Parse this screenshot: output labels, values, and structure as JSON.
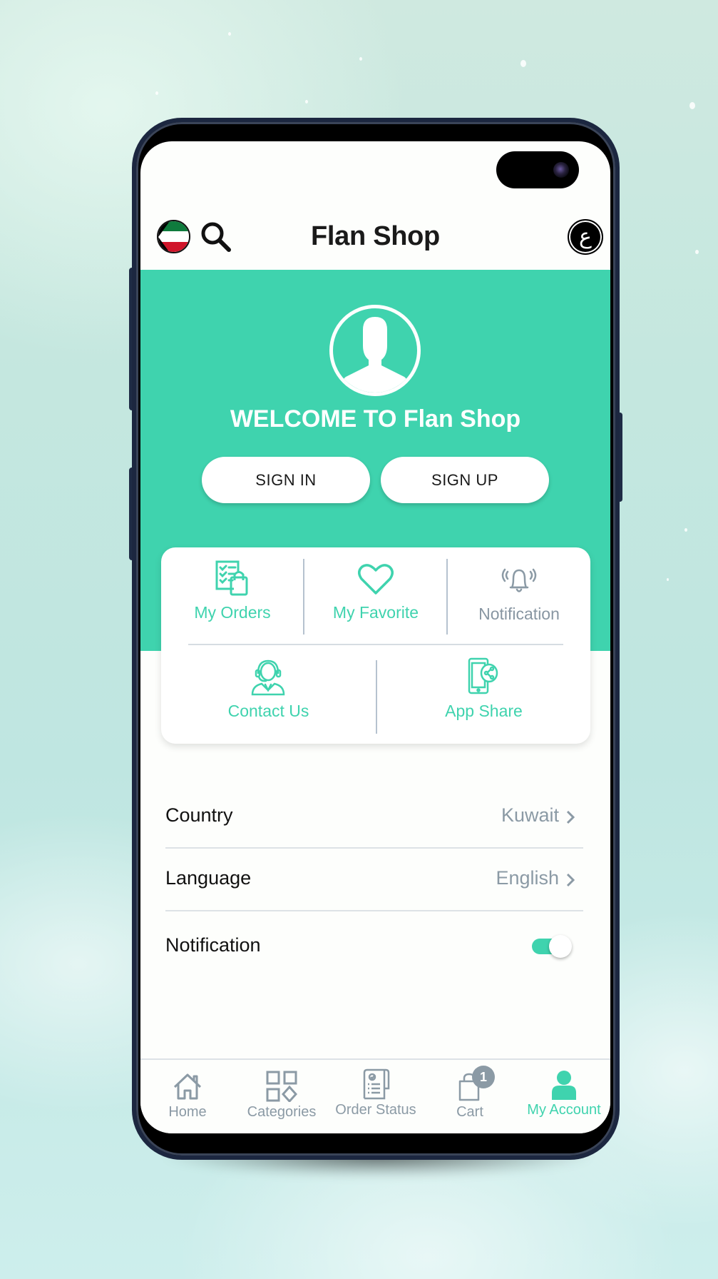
{
  "app": {
    "title": "Flan Shop",
    "accent_color": "#3fd3ae",
    "muted_color": "#8b9aa5"
  },
  "header": {
    "country_flag": "kuwait-flag",
    "search_icon": "search-icon",
    "title": "Flan Shop",
    "language_toggle_glyph": "ع"
  },
  "hero": {
    "avatar_icon": "user-silhouette-icon",
    "welcome_text": "WELCOME TO Flan Shop",
    "sign_in_label": "SIGN IN",
    "sign_up_label": "SIGN UP"
  },
  "quick_actions": [
    {
      "label": "My Orders",
      "icon": "orders-checklist-bag-icon",
      "state": "active"
    },
    {
      "label": "My Favorite",
      "icon": "heart-icon",
      "state": "active"
    },
    {
      "label": "Notification",
      "icon": "ringing-bell-icon",
      "state": "muted"
    },
    {
      "label": "Contact Us",
      "icon": "support-agent-headset-icon",
      "state": "active"
    },
    {
      "label": "App Share",
      "icon": "phone-share-icon",
      "state": "active"
    }
  ],
  "settings": [
    {
      "label": "Country",
      "value": "Kuwait",
      "type": "link"
    },
    {
      "label": "Language",
      "value": "English",
      "type": "link"
    },
    {
      "label": "Notification",
      "type": "toggle",
      "enabled": true
    }
  ],
  "bottom_nav": [
    {
      "label": "Home",
      "icon": "home-icon",
      "active": false
    },
    {
      "label": "Categories",
      "icon": "categories-grid-icon",
      "active": false
    },
    {
      "label": "Order Status",
      "icon": "order-receipt-icon",
      "active": false
    },
    {
      "label": "Cart",
      "icon": "shopping-bag-icon",
      "active": false,
      "badge": "1"
    },
    {
      "label": "My Account",
      "icon": "account-person-icon",
      "active": true
    }
  ]
}
